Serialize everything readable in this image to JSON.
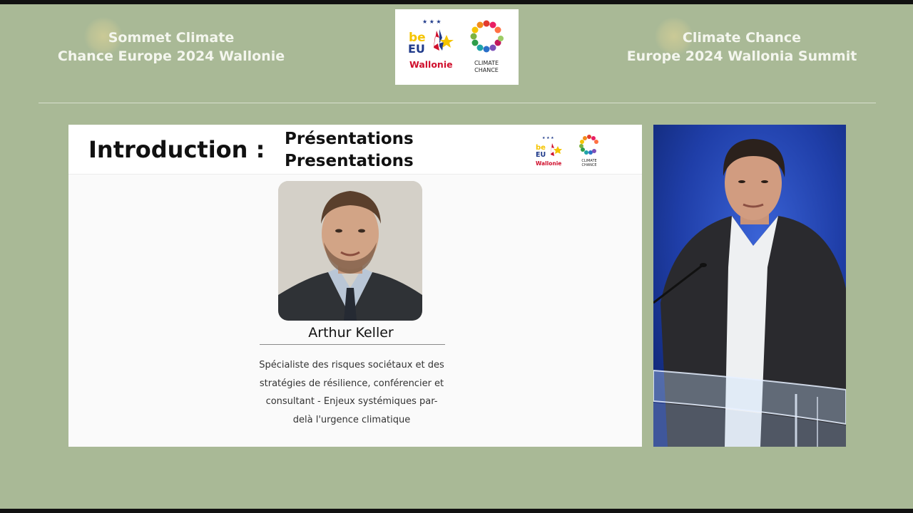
{
  "header": {
    "title_fr_line1": "Sommet Climate",
    "title_fr_line2": "Chance Europe 2024 Wallonie",
    "title_en_line1": "Climate Chance",
    "title_en_line2": "Europe 2024 Wallonia Summit"
  },
  "logos": {
    "be_text": "be",
    "eu_text": "EU",
    "wallonie_text": "Wallonie",
    "climate_text": "CLIMATE",
    "chance_text": "CHANCE"
  },
  "slide": {
    "intro_label": "Introduction :",
    "presentations_fr": "Présentations",
    "presentations_en": "Presentations",
    "speaker_name": "Arthur Keller",
    "bio": [
      "Spécialiste des risques sociétaux et des",
      "stratégies de résilience, conférencier et",
      "consultant - Enjeux systémiques par-",
      "delà l'urgence climatique"
    ]
  },
  "colors": {
    "background": "#a9b996",
    "wallonie_red": "#d0102d",
    "eu_blue": "#1f3a8a",
    "be_yellow": "#f5c400",
    "stage_blue": "#1c3a9e"
  }
}
